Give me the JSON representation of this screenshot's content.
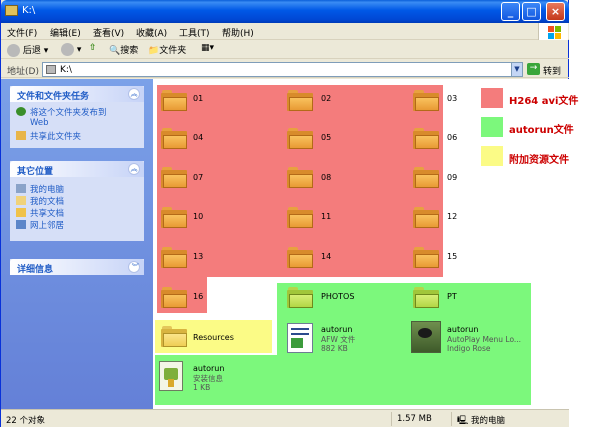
{
  "window": {
    "title": "K:\\"
  },
  "menu": [
    "文件(F)",
    "编辑(E)",
    "查看(V)",
    "收藏(A)",
    "工具(T)",
    "帮助(H)"
  ],
  "toolbar": {
    "back": "后退",
    "search": "搜索",
    "folders": "文件夹"
  },
  "address": {
    "label": "地址(D)",
    "value": "K:\\",
    "go": "转到"
  },
  "sidebar": {
    "tasks": {
      "title": "文件和文件夹任务",
      "items": [
        "将这个文件夹发布到",
        "Web",
        "共享此文件夹"
      ]
    },
    "places": {
      "title": "其它位置",
      "items": [
        "我的电脑",
        "我的文档",
        "共享文档",
        "网上邻居"
      ]
    },
    "details": {
      "title": "详细信息"
    }
  },
  "folders": {
    "red": [
      "01",
      "02",
      "03",
      "04",
      "05",
      "06",
      "07",
      "08",
      "09",
      "10",
      "11",
      "12",
      "13",
      "14",
      "15",
      "16"
    ],
    "yellow": "Resources",
    "green": [
      "PHOTOS",
      "PT"
    ]
  },
  "files": {
    "autorun_inf": {
      "name": "autorun",
      "type": "AFW 文件",
      "size": "882 KB"
    },
    "autorun_exe": {
      "name": "autorun",
      "type": "AutoPlay Menu Lo...",
      "vendor": "Indigo Rose"
    },
    "autorun_ico": {
      "name": "autorun",
      "type": "安装信息",
      "size": "1 KB"
    }
  },
  "legend": [
    {
      "label": "H264 avi文件",
      "color": "#f47c7c"
    },
    {
      "label": "autorun文件",
      "color": "#7cf87c"
    },
    {
      "label": "附加资源文件",
      "color": "#fbfb86"
    }
  ],
  "status": {
    "count": "22 个对象",
    "size": "1.57 MB",
    "location": "我的电脑"
  }
}
